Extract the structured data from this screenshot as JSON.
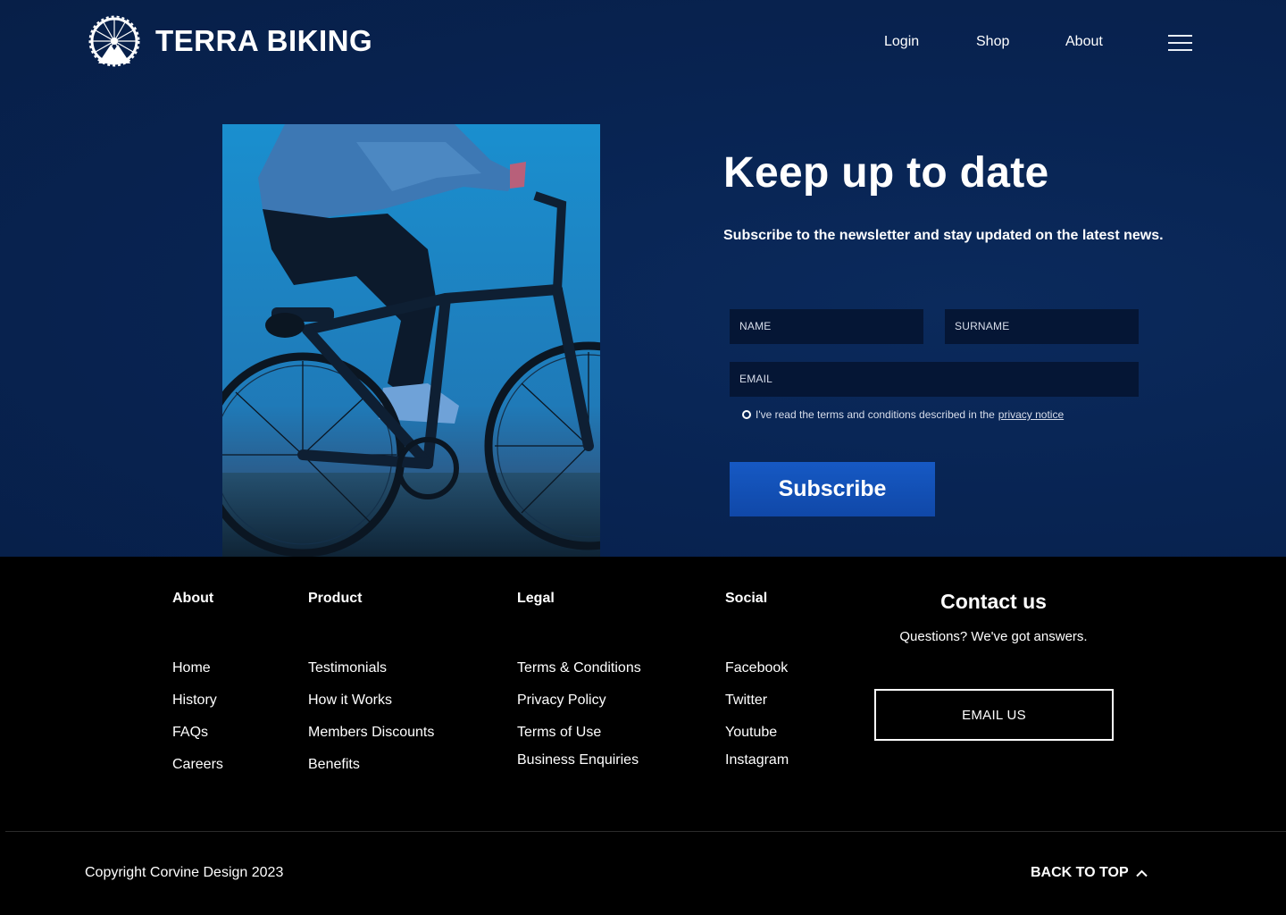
{
  "header": {
    "brand": "TERRA BIKING",
    "nav": [
      "Login",
      "Shop",
      "About"
    ]
  },
  "newsletter": {
    "title": "Keep up to date",
    "subtitle": "Subscribe to the newsletter and stay updated on the latest news.",
    "name_placeholder": "NAME",
    "surname_placeholder": "SURNAME",
    "email_placeholder": "EMAIL",
    "terms_text": "I've read the terms and conditions described in the",
    "terms_link": "privacy notice",
    "subscribe_label": "Subscribe"
  },
  "footer": {
    "about": {
      "title": "About",
      "links": [
        "Home",
        "History",
        "FAQs",
        "Careers"
      ]
    },
    "product": {
      "title": "Product",
      "links": [
        "Testimonials",
        "How it Works",
        "Members Discounts",
        "Benefits"
      ]
    },
    "legal": {
      "title": "Legal",
      "links": [
        "Terms & Conditions",
        "Privacy Policy",
        "Terms of Use",
        "Business Enquiries"
      ]
    },
    "social": {
      "title": "Social",
      "links": [
        "Facebook",
        "Twitter",
        "Youtube",
        "Instagram"
      ]
    },
    "contact": {
      "title": "Contact us",
      "subtitle": "Questions? We've got answers.",
      "button": "EMAIL US"
    },
    "copyright": "Copyright Corvine Design 2023",
    "back_to_top": "BACK TO TOP"
  },
  "colors": {
    "background_top": "#082453",
    "background_footer": "#000000",
    "button_blue": "#1352b8",
    "input_bg": "#051635"
  }
}
